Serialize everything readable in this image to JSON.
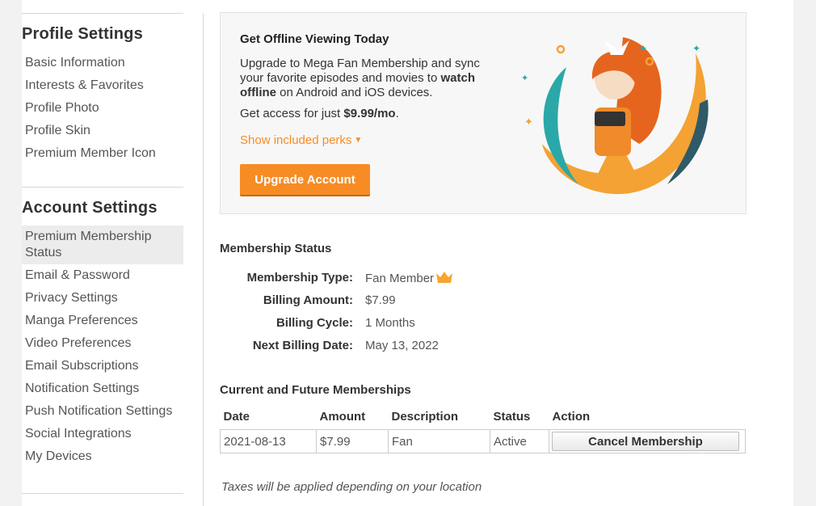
{
  "sidebar": {
    "profile_title": "Profile Settings",
    "profile_items": [
      {
        "label": "Basic Information"
      },
      {
        "label": "Interests & Favorites"
      },
      {
        "label": "Profile Photo"
      },
      {
        "label": "Profile Skin"
      },
      {
        "label": "Premium Member Icon"
      }
    ],
    "account_title": "Account Settings",
    "account_items": [
      {
        "label": "Premium Membership Status",
        "active": true
      },
      {
        "label": "Email & Password"
      },
      {
        "label": "Privacy Settings"
      },
      {
        "label": "Manga Preferences"
      },
      {
        "label": "Video Preferences"
      },
      {
        "label": "Email Subscriptions"
      },
      {
        "label": "Notification Settings"
      },
      {
        "label": "Push Notification Settings"
      },
      {
        "label": "Social Integrations"
      },
      {
        "label": "My Devices"
      }
    ]
  },
  "promo": {
    "title": "Get Offline Viewing Today",
    "body_pre": "Upgrade to Mega Fan Membership and sync your favorite episodes and movies to ",
    "body_bold": "watch offline",
    "body_post": " on Android and iOS devices.",
    "price_pre": "Get access for just ",
    "price_bold": "$9.99/mo",
    "price_post": ".",
    "perks_label": "Show included perks",
    "upgrade_label": "Upgrade Account",
    "accent_color": "#f78c25"
  },
  "membership": {
    "title": "Membership Status",
    "rows": [
      {
        "label": "Membership Type:",
        "value": "Fan Member",
        "icon": "crown-icon"
      },
      {
        "label": "Billing Amount:",
        "value": "$7.99"
      },
      {
        "label": "Billing Cycle:",
        "value": "1 Months"
      },
      {
        "label": "Next Billing Date:",
        "value": "May 13, 2022"
      }
    ]
  },
  "memberships_table": {
    "title": "Current and Future Memberships",
    "headers": [
      "Date",
      "Amount",
      "Description",
      "Status",
      "Action"
    ],
    "rows": [
      {
        "date": "2021-08-13",
        "amount": "$7.99",
        "description": "Fan",
        "status": "Active",
        "action": "Cancel Membership"
      }
    ]
  },
  "tax_note": "Taxes will be applied depending on your location"
}
